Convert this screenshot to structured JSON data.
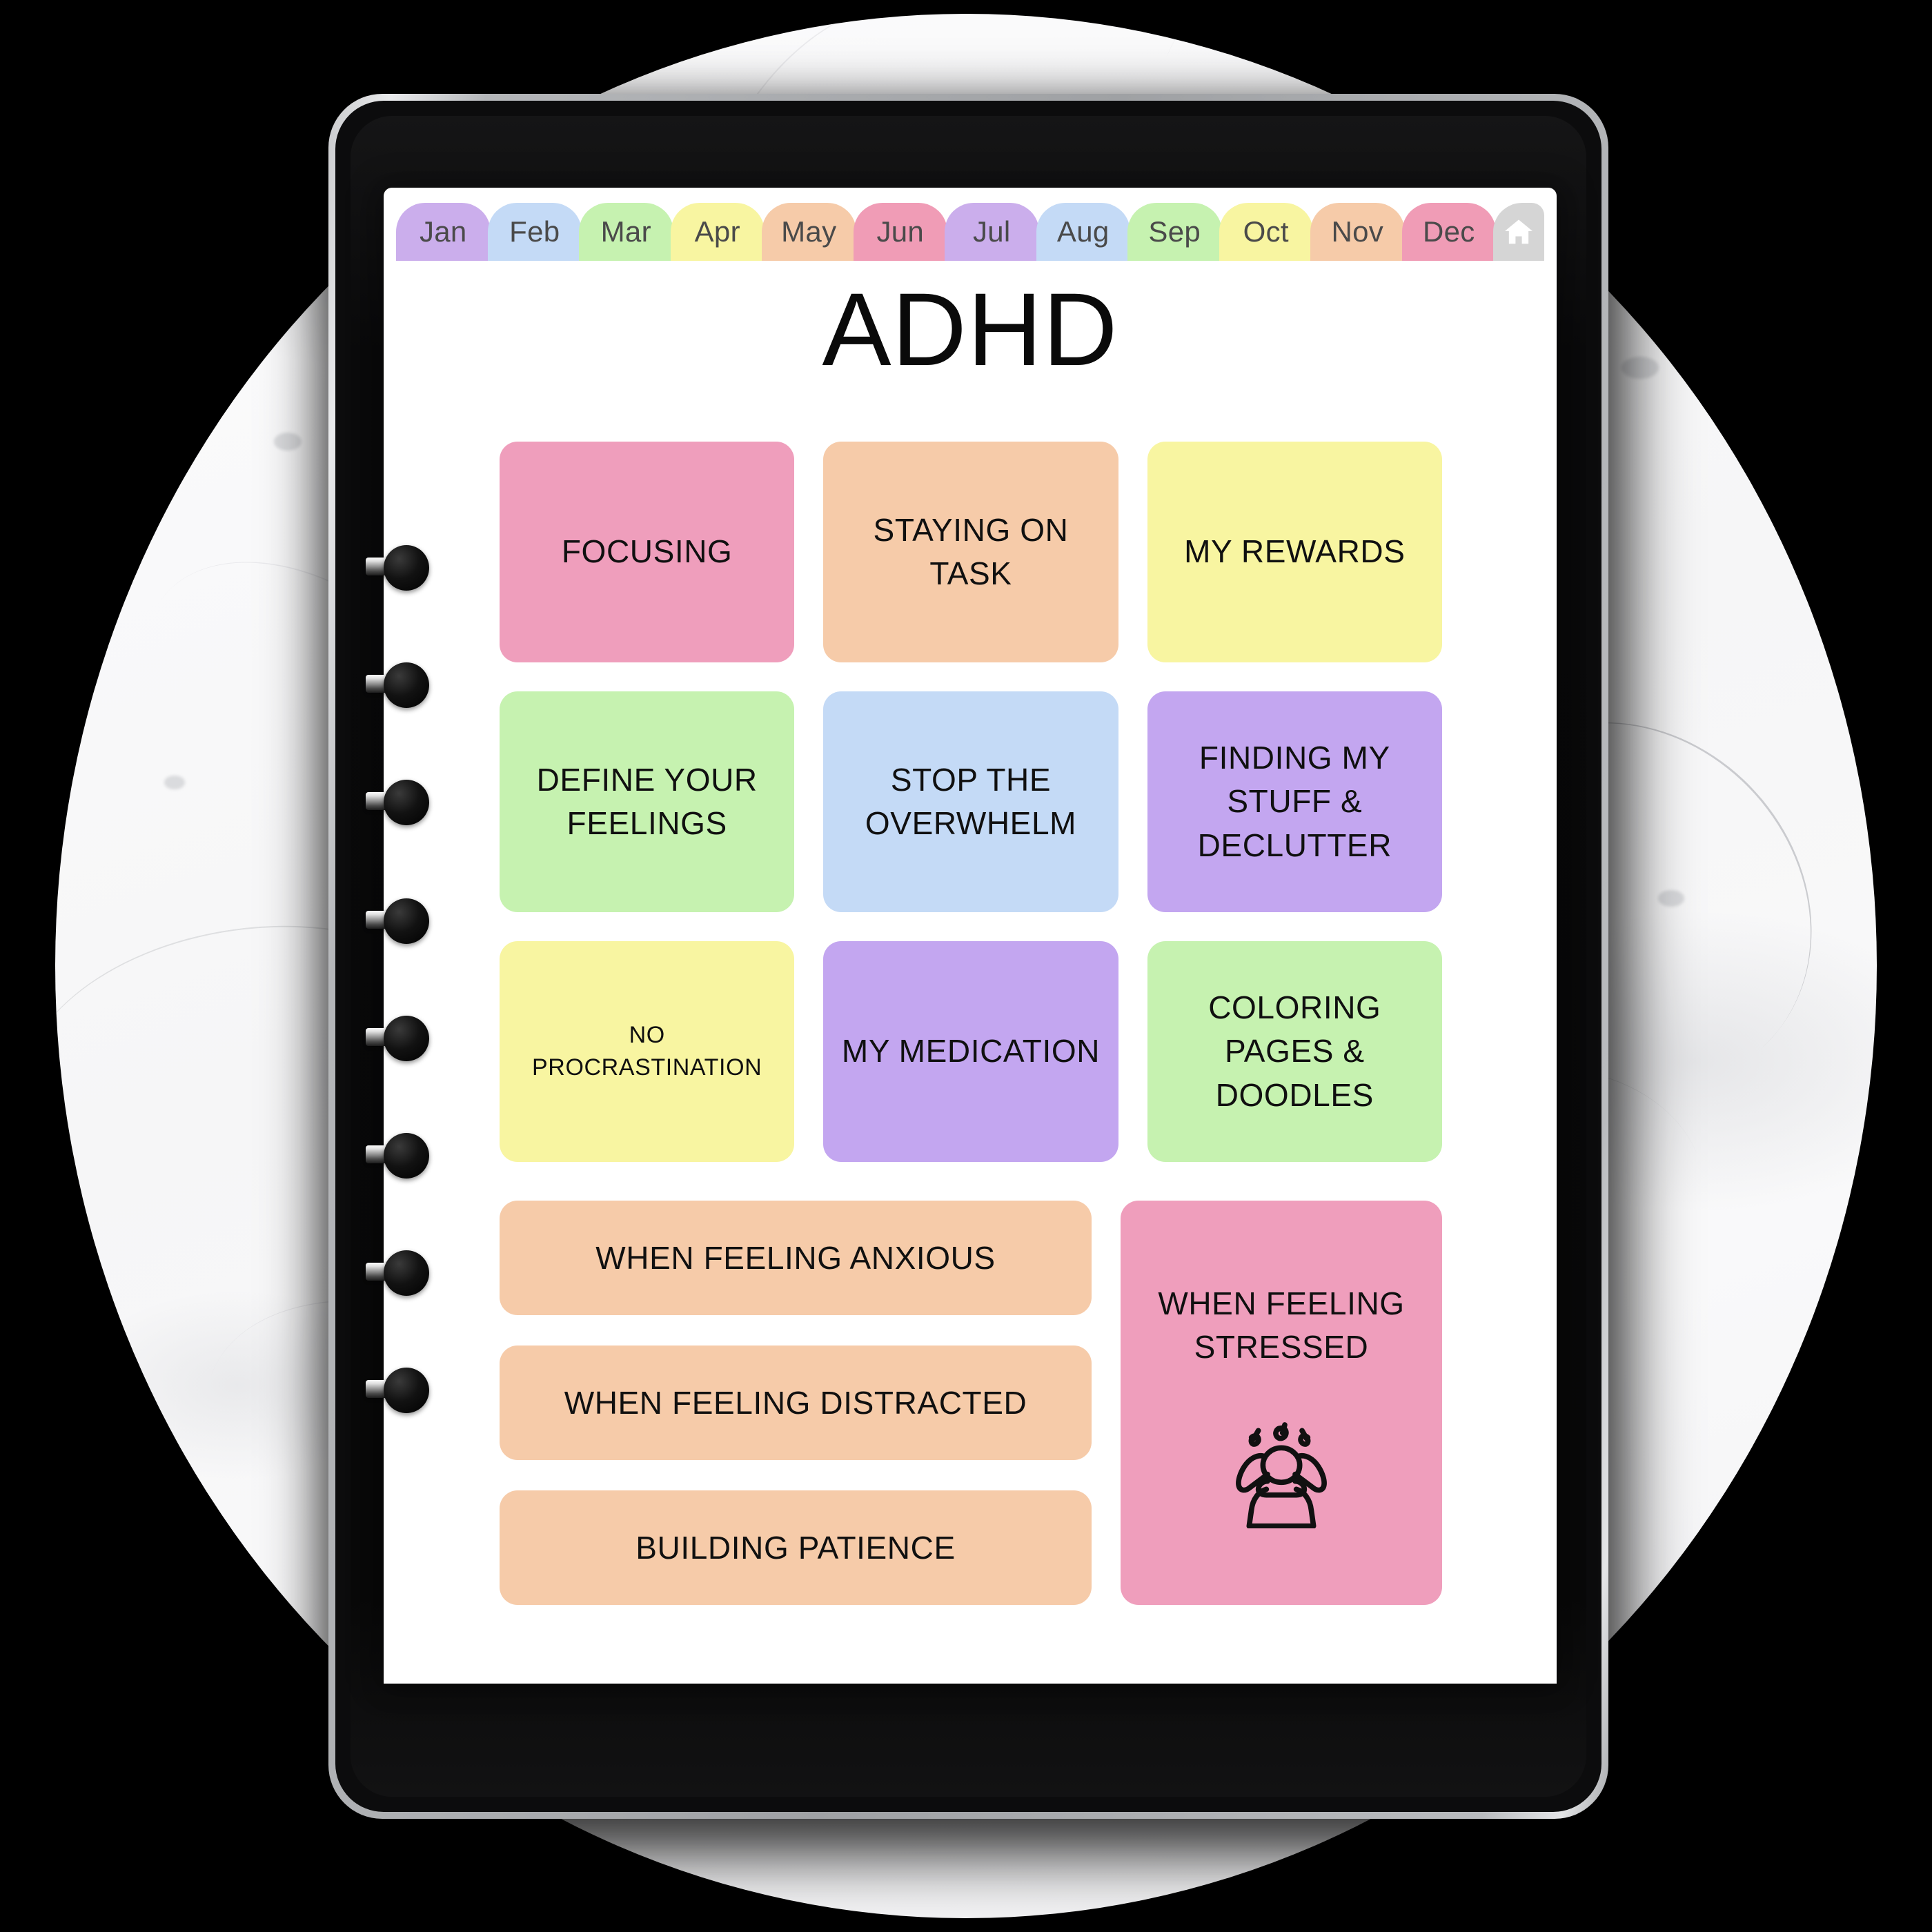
{
  "device": {
    "type": "tablet",
    "sensor_icons": [
      "camera-dot",
      "camera-dot",
      "camera-module",
      "sensor-dot",
      "camera-dot",
      "indicator-light"
    ]
  },
  "background": {
    "surface": "white-marble",
    "shape": "circle",
    "outside_color": "#000000"
  },
  "binder": {
    "ring_count": 8,
    "ring_color": "#0d0d0d",
    "bar_color": "#8d8d8d"
  },
  "tabs": {
    "items": [
      {
        "label": "Jan",
        "color": "#CBAEEC"
      },
      {
        "label": "Feb",
        "color": "#C4DAF6"
      },
      {
        "label": "Mar",
        "color": "#C6F2B0"
      },
      {
        "label": "Apr",
        "color": "#F8F5A1"
      },
      {
        "label": "May",
        "color": "#F6CBA9"
      },
      {
        "label": "Jun",
        "color": "#F09CB6"
      },
      {
        "label": "Jul",
        "color": "#CBAEEC"
      },
      {
        "label": "Aug",
        "color": "#C4DAF6"
      },
      {
        "label": "Sep",
        "color": "#C6F2B0"
      },
      {
        "label": "Oct",
        "color": "#F8F5A1"
      },
      {
        "label": "Nov",
        "color": "#F6CBA9"
      },
      {
        "label": "Dec",
        "color": "#F09CB6"
      }
    ],
    "home": {
      "icon": "home-icon",
      "color": "#D5D5D5",
      "glyph_color": "#FFFFFF"
    }
  },
  "page": {
    "title": "ADHD",
    "background": "#FFFFFF"
  },
  "grid": {
    "rows": [
      [
        {
          "label": "FOCUSING",
          "color": "#EF9EBC",
          "small": false
        },
        {
          "label": "STAYING ON TASK",
          "color": "#F6CBA9",
          "small": false
        },
        {
          "label": "MY REWARDS",
          "color": "#F8F5A1",
          "small": false
        }
      ],
      [
        {
          "label": "DEFINE YOUR FEELINGS",
          "color": "#C6F2B0",
          "small": false
        },
        {
          "label": "STOP THE OVERWHELM",
          "color": "#C4DAF6",
          "small": false
        },
        {
          "label": "FINDING MY STUFF & DECLUTTER",
          "color": "#C3A6F0",
          "small": false
        }
      ],
      [
        {
          "label": "NO PROCRASTINATION",
          "color": "#F8F5A1",
          "small": true
        },
        {
          "label": "MY MEDICATION",
          "color": "#C3A6F0",
          "small": false
        },
        {
          "label": "COLORING PAGES & DOODLES",
          "color": "#C6F2B0",
          "small": false
        }
      ]
    ]
  },
  "bottom": {
    "bars": [
      {
        "label": "WHEN FEELING ANXIOUS",
        "color": "#F6CBA9"
      },
      {
        "label": "WHEN FEELING DISTRACTED",
        "color": "#F6CBA9"
      },
      {
        "label": "BUILDING PATIENCE",
        "color": "#F6CBA9"
      }
    ],
    "stress_tile": {
      "label": "WHEN FEELING STRESSED",
      "color": "#EF9EBC",
      "icon": "stressed-person-icon"
    }
  }
}
